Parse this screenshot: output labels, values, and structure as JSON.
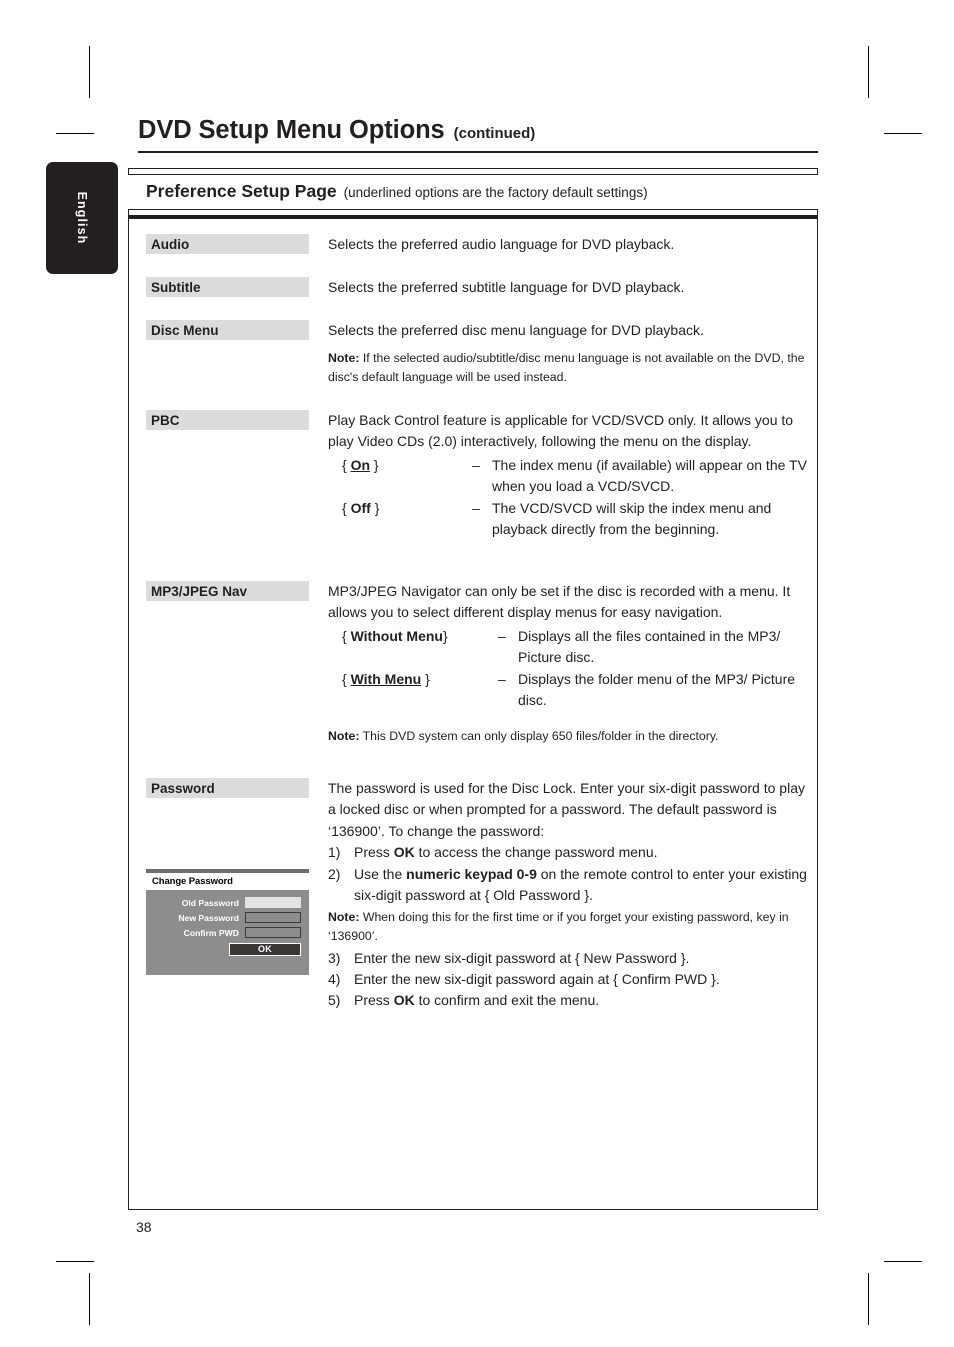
{
  "page": {
    "number": "38",
    "language_tab": "English"
  },
  "header": {
    "title": "DVD Setup Menu Options",
    "continued": "(continued)"
  },
  "section": {
    "title": "Preference Setup Page",
    "subtitle": "(underlined options are the factory default settings)"
  },
  "rows": {
    "audio": {
      "label": "Audio",
      "description": "Selects the preferred audio language for DVD playback."
    },
    "subtitle": {
      "label": "Subtitle",
      "description": "Selects the preferred subtitle language for DVD playback."
    },
    "disc_menu": {
      "label": "Disc Menu",
      "description": "Selects the preferred disc menu language for DVD playback.",
      "note_label": "Note:",
      "note_text": "If the selected audio/subtitle/disc menu language is not available on the DVD, the disc's default language will be used instead."
    },
    "pbc": {
      "label": "PBC",
      "description": "Play Back Control feature is applicable for VCD/SVCD only.  It allows you to play Video CDs (2.0) interactively, following the menu on the display.",
      "options": [
        {
          "open_brace": "{",
          "value": "On",
          "close_brace": "}",
          "dash": "–",
          "description": "The index menu (if available) will appear on the TV when you load a VCD/SVCD.",
          "default": true
        },
        {
          "open_brace": "{",
          "value": "Off",
          "close_brace": "}",
          "dash": "–",
          "description": "The VCD/SVCD will skip the index menu and playback directly from the beginning.",
          "default": false
        }
      ]
    },
    "mp3_jpeg_nav": {
      "label": "MP3/JPEG Nav",
      "description": "MP3/JPEG Navigator can only be set if the disc is recorded with a menu.  It allows you to select different display menus for easy navigation.",
      "options": [
        {
          "open_brace": "{",
          "value": "Without Menu",
          "close_brace": "}",
          "dash": "–",
          "description": "Displays all the files contained in the MP3/ Picture disc.",
          "default": false
        },
        {
          "open_brace": "{",
          "value": "With Menu",
          "close_brace": "}",
          "dash": "–",
          "description": "Displays the folder menu of the MP3/ Picture disc.",
          "default": true
        }
      ],
      "note_label": "Note:",
      "note_text": "This DVD system can only display 650 files/folder in the directory."
    },
    "password": {
      "label": "Password",
      "description_part1": "The password is used for the Disc Lock.  Enter your six-digit password to play a locked disc or when prompted for a password.  The default password is ‘136900’.  To change the password:",
      "steps": [
        {
          "num": "1)",
          "pre": "Press ",
          "bold": "OK",
          "post": " to access the change password menu."
        },
        {
          "num": "2)",
          "pre": "Use the ",
          "bold": "numeric keypad 0-9",
          "post": " on the remote control to enter your existing six-digit password at { Old Password }."
        }
      ],
      "note_label": "Note:",
      "note_text": "When doing this for the first time or if you forget your existing password, key in ‘136900’.",
      "steps2": [
        {
          "num": "3)",
          "pre": "Enter the new six-digit password at { New Password }.",
          "bold": "",
          "post": ""
        },
        {
          "num": "4)",
          "pre": "Enter the new six-digit password again at { Confirm PWD }.",
          "bold": "",
          "post": ""
        },
        {
          "num": "5)",
          "pre": "Press ",
          "bold": "OK",
          "post": " to confirm and exit the menu."
        }
      ]
    }
  },
  "osd": {
    "title": "Change Password",
    "fields": [
      {
        "label": "Old Password",
        "active": true
      },
      {
        "label": "New Password",
        "active": false
      },
      {
        "label": "Confirm PWD",
        "active": false
      }
    ],
    "ok_label": "OK"
  },
  "colors": {
    "ink": "#231f20",
    "chip_gray": "#dcdcdc",
    "osd_gray": "#8d8d8d",
    "osd_dark": "#3a3633"
  }
}
